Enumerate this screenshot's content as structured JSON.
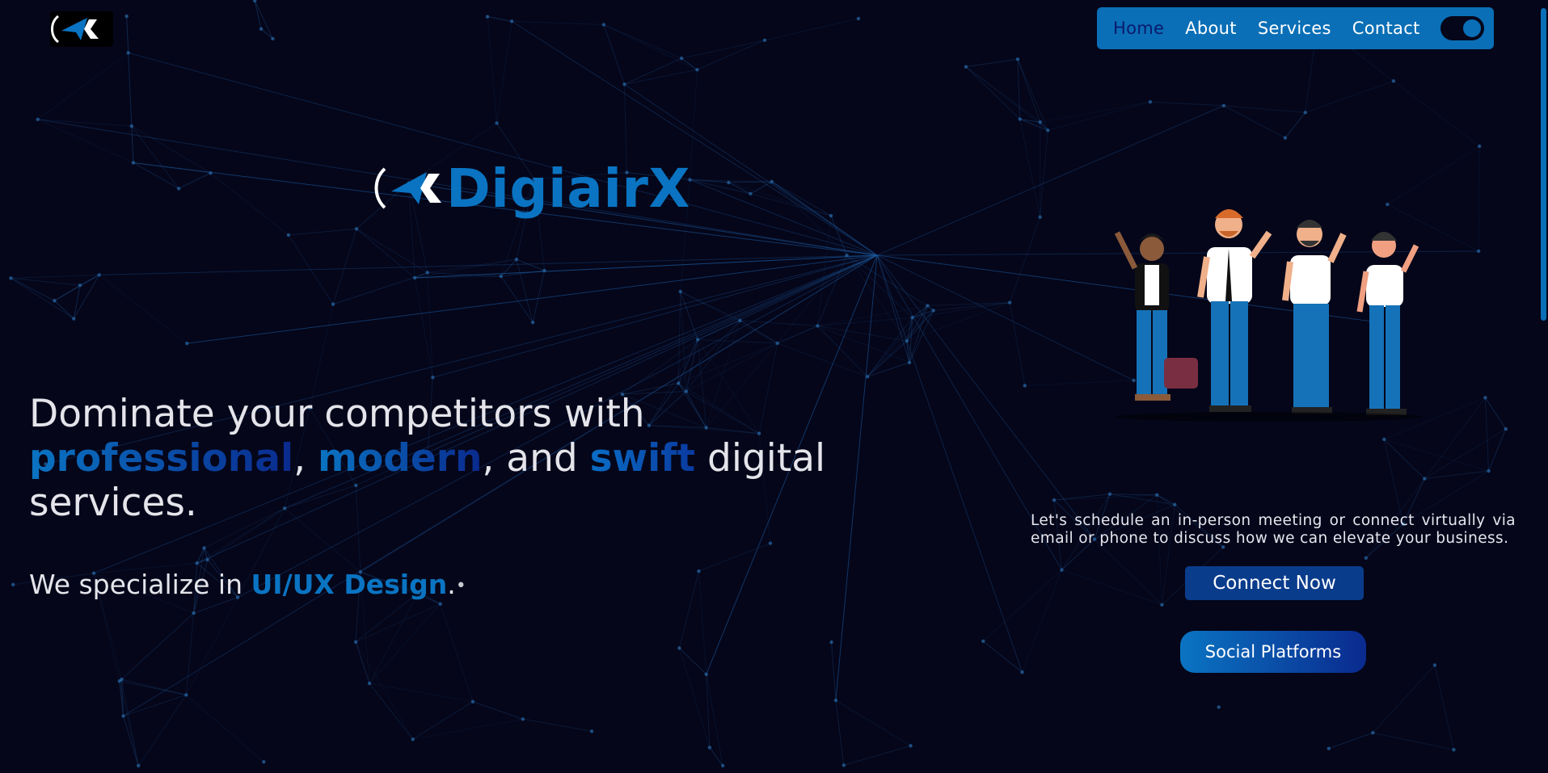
{
  "brand": {
    "name": "DigiairX"
  },
  "nav": {
    "items": [
      {
        "label": "Home"
      },
      {
        "label": "About"
      },
      {
        "label": "Services"
      },
      {
        "label": "Contact"
      }
    ]
  },
  "hero": {
    "line_start": "Dominate your competitors with",
    "word_professional": "professional",
    "comma1": ",",
    "word_modern": "modern",
    "and_text": ", and",
    "word_swift": "swift",
    "line_end": "digital services.",
    "specialize_prefix": "We specialize in",
    "specialize_value": "UI/UX Design",
    "specialize_suffix": ".",
    "cursor_dot": "•"
  },
  "contact": {
    "intro": "Let's schedule an in-person meeting or connect virtually via email or phone to discuss how we can elevate your business.",
    "connect_label": "Connect Now",
    "social_label": "Social Platforms"
  },
  "colors": {
    "background": "#05061a",
    "accent": "#0a74c2",
    "nav_bg": "#0a6fb6",
    "dark_blue": "#0a3c8c"
  }
}
